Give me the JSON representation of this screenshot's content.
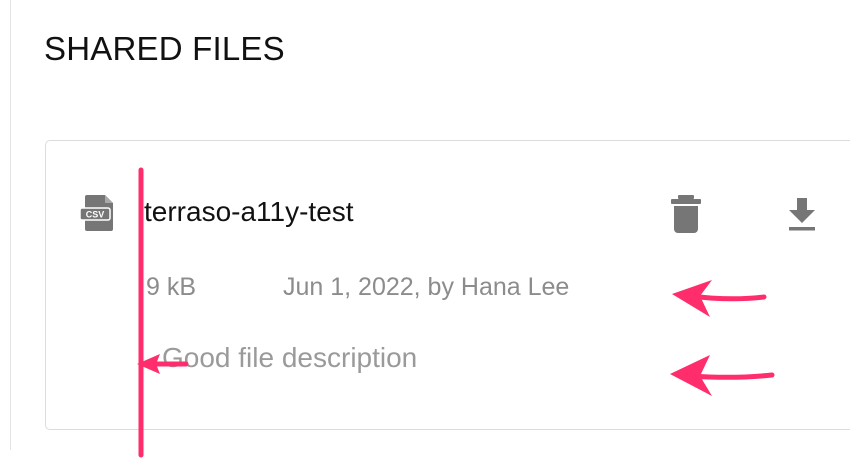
{
  "section": {
    "title": "SHARED FILES"
  },
  "file": {
    "type_icon": "csv-file-icon",
    "type_label": "CSV",
    "name": "terraso-a11y-test",
    "size": "9 kB",
    "meta": "Jun 1, 2022, by Hana Lee",
    "description": "Good file description"
  },
  "actions": {
    "delete_icon": "trash-icon",
    "download_icon": "download-icon"
  },
  "colors": {
    "annotation": "#ff2d6b",
    "text_primary": "#111111",
    "text_secondary": "#8c8c8c",
    "icon_gray": "#767676",
    "card_border": "#dcdcdc"
  }
}
